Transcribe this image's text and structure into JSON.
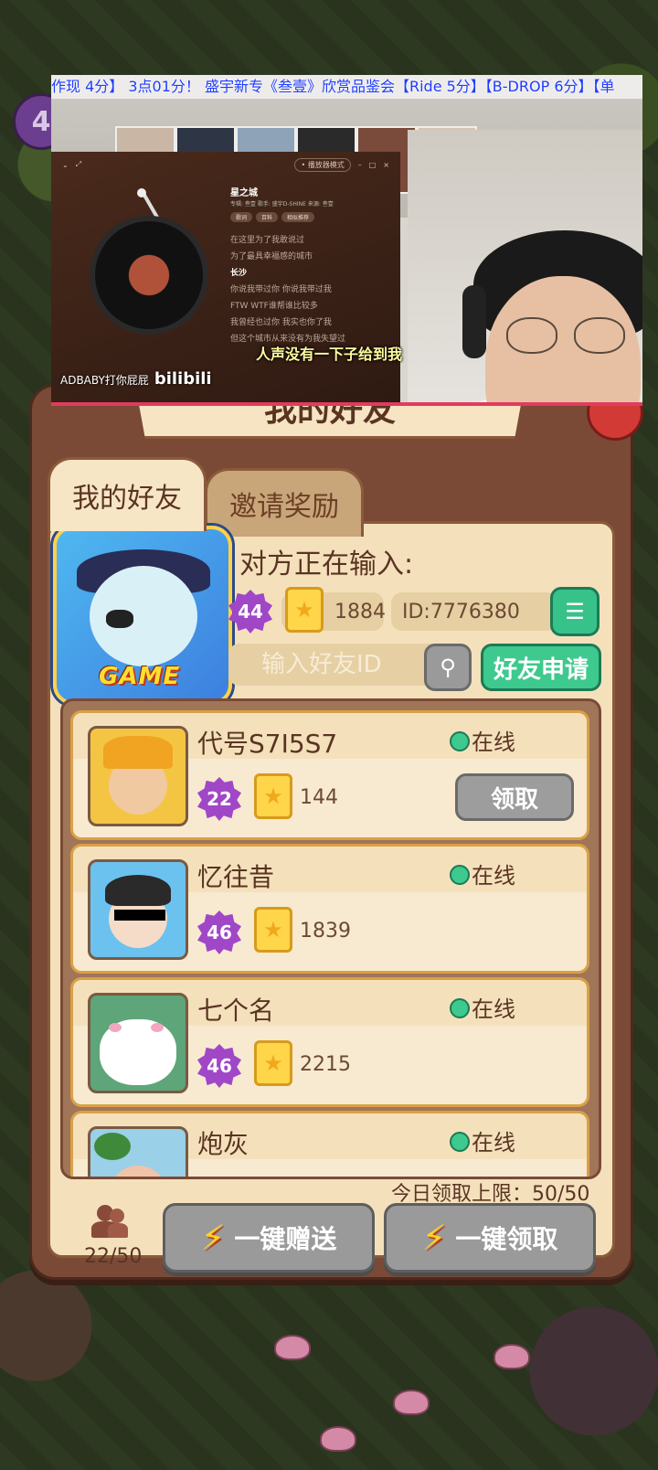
{
  "stream": {
    "ticker": "作现 4分】 3点01分！ 盛宇新专《叁壹》欣赏品鉴会【Ride 5分】【B-DROP 6分】【单",
    "player": {
      "mode_label": "• 播放器模式",
      "song_title": "星之城",
      "song_meta": "专辑: 叁壹   歌手: 盛宇D-SHINE   来源: 叁壹",
      "tabs": [
        "歌词",
        "百科",
        "相似推荐"
      ],
      "lyrics": [
        "在这里为了我敢说过",
        "为了最具幸福感的城市",
        "长沙",
        "你说我带过你 你说我带过我",
        "FTW WTF谁帮谁比较多",
        "我曾经也过你 我实也你了我",
        "但这个城市从来没有为我失望过"
      ],
      "current_lyric_index": 2,
      "progress": 0.7
    },
    "subtitle": "人声没有一下子给到我",
    "watermark": "ADBABY打你屁屁",
    "watermark_logo": "bilibili"
  },
  "backdrop": {
    "level": "4"
  },
  "panel": {
    "title": "我的好友",
    "tabs": {
      "friends": "我的好友",
      "invite": "邀请奖励"
    },
    "profile": {
      "status": "对方正在输入:",
      "level": "44",
      "medals": "1884",
      "id": "ID:7776380",
      "card_label": "GAME"
    },
    "search": {
      "placeholder": "输入好友ID",
      "request_label": "好友申请"
    },
    "friends": [
      {
        "name": "代号S7I5S7",
        "status": "在线",
        "level": "22",
        "medals": "144",
        "action": "领取"
      },
      {
        "name": "忆往昔",
        "status": "在线",
        "level": "46",
        "medals": "1839"
      },
      {
        "name": "七个名",
        "status": "在线",
        "level": "46",
        "medals": "2215"
      },
      {
        "name": "炮灰",
        "status": "在线"
      }
    ],
    "daily_limit": "今日领取上限：50/50",
    "friend_count": "22/50",
    "send_all": "一键赠送",
    "claim_all": "一键领取"
  },
  "colors": {
    "panel": "#7a4a36",
    "inner": "#f4e1bc",
    "green": "#3ec98e",
    "level_purple": "#a047c8",
    "medal_gold": "#ffd54a",
    "disabled_gray": "#9a9a9a"
  }
}
